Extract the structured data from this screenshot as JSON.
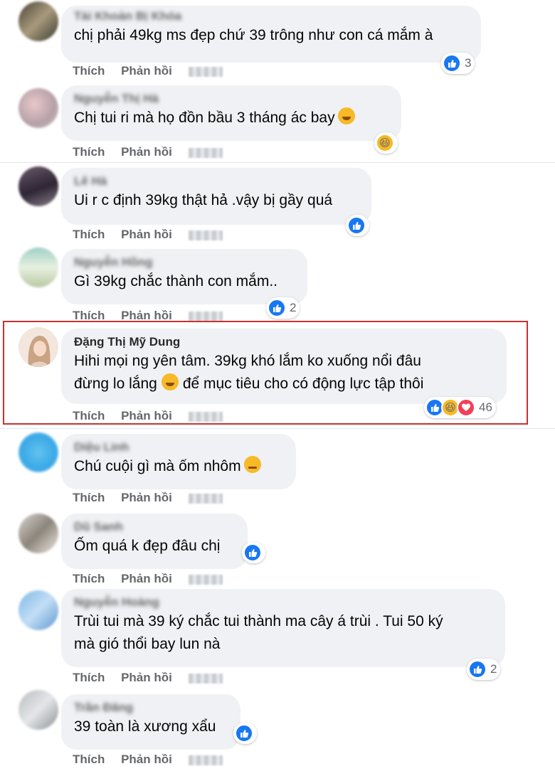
{
  "actions": {
    "like": "Thích",
    "reply": "Phản hồi"
  },
  "comments": [
    {
      "name": "Tài Khoản Bị Khóa",
      "text": "chị phải 49kg ms đẹp chứ 39 trông như con cá mắm à",
      "reactions": "3"
    },
    {
      "name": "Nguyễn Thị Hà",
      "text": "Chị tui ri mà họ đồn bầu 3 tháng ác bay",
      "reactions": ""
    },
    {
      "name": "Lê Hà",
      "text": "Ui r c định 39kg thật hả .vậy bị gầy quá",
      "reactions": ""
    },
    {
      "name": "Nguyễn Hồng",
      "text": "Gì 39kg chắc thành con mắm..",
      "reactions": "2"
    },
    {
      "name": "Đặng Thị Mỹ Dung",
      "line1": "Hihi mọi ng yên tâm. 39kg khó lắm ko xuống nổi đâu",
      "line2a": "đừng lo lắng",
      "line2b": "để mục tiêu cho có động lực tập thôi",
      "reactions": "46"
    },
    {
      "name": "Diệu Linh",
      "text": "Chú cuội gì mà ốm nhôm",
      "reactions": ""
    },
    {
      "name": "Dũ Sanh",
      "text": "Ốm quá k đẹp đâu chị",
      "reactions": ""
    },
    {
      "name": "Nguyễn Hoàng",
      "line1": "Trùi tui mà 39 ký chắc tui thành ma cây á trùi . Tui 50 ký",
      "line2": "mà gió thổi bay lun nà",
      "reactions": "2"
    },
    {
      "name": "Trần Đăng",
      "text": "39 toàn là xương xẩu",
      "reactions": ""
    }
  ],
  "colors": {
    "like": "#1877f2",
    "haha": "#f7b928",
    "love": "#f33e58",
    "highlight": "#c93030",
    "bubble": "#eff1f4"
  }
}
